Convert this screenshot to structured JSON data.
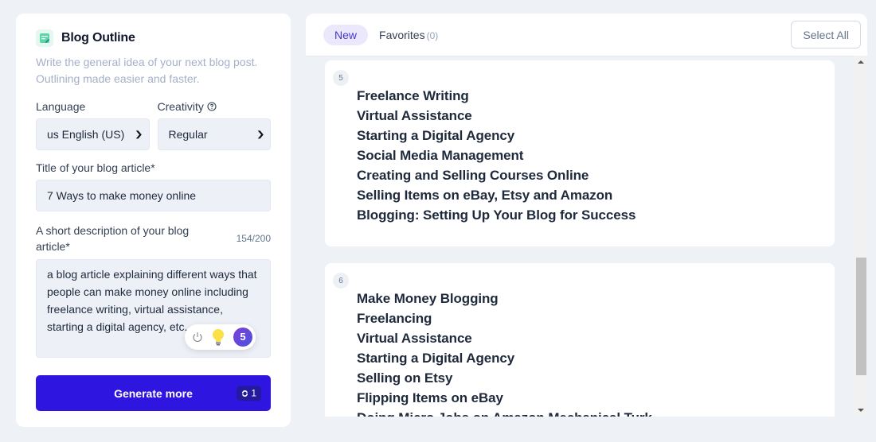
{
  "left": {
    "title": "Blog Outline",
    "title_icon": "edit-document-icon",
    "subtitle": "Write the general idea of your next blog post. Outlining made easier and faster.",
    "language": {
      "label": "Language",
      "value": "us English (US)"
    },
    "creativity": {
      "label": "Creativity",
      "value": "Regular",
      "help_icon": "help-circle-icon"
    },
    "title_field": {
      "label": "Title of your blog article*",
      "value": "7 Ways to make money online"
    },
    "description": {
      "label": "A short description of your blog article*",
      "counter": "154/200",
      "value": "a blog article explaining different ways that people can make money online including freelance writing, virtual assistance, starting a digital agency, etc."
    },
    "tools": {
      "power_icon": "power-icon",
      "bulb_icon": "lightbulb-icon",
      "badge": "5"
    },
    "generate": {
      "label": "Generate more",
      "credit": "1",
      "credit_icon": "refresh-icon"
    }
  },
  "right": {
    "tabs": [
      {
        "label": "New",
        "active": true
      },
      {
        "label": "Favorites",
        "count": "(0)",
        "active": false
      }
    ],
    "select_all": "Select All",
    "cards": [
      {
        "number": "5",
        "items": [
          "Freelance Writing",
          "Virtual Assistance",
          "Starting a Digital Agency",
          "Social Media Management",
          "Creating and Selling Courses Online",
          "Selling Items on eBay, Etsy and Amazon",
          "Blogging: Setting Up Your Blog for Success"
        ]
      },
      {
        "number": "6",
        "items": [
          "Make Money Blogging",
          "Freelancing",
          "Virtual Assistance",
          "Starting a Digital Agency",
          "Selling on Etsy",
          "Flipping Items on eBay",
          "Doing Micro Jobs on Amazon Mechanical Turk"
        ]
      }
    ]
  },
  "colors": {
    "primary_button": "#2e15e0",
    "active_tab_bg": "#ece8fc",
    "active_tab_text": "#4338ca"
  }
}
